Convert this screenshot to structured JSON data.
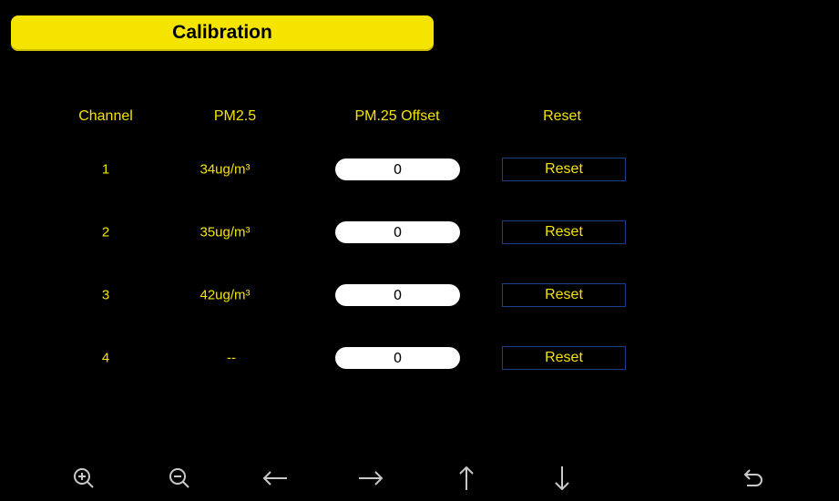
{
  "header": {
    "title": "Calibration"
  },
  "columns": {
    "channel": "Channel",
    "pm25": "PM2.5",
    "offset": "PM.25 Offset",
    "reset": "Reset"
  },
  "rows": [
    {
      "channel": "1",
      "pm25": "34ug/m³",
      "offset": "0",
      "reset_label": "Reset"
    },
    {
      "channel": "2",
      "pm25": "35ug/m³",
      "offset": "0",
      "reset_label": "Reset"
    },
    {
      "channel": "3",
      "pm25": "42ug/m³",
      "offset": "0",
      "reset_label": "Reset"
    },
    {
      "channel": "4",
      "pm25": "--",
      "offset": "0",
      "reset_label": "Reset"
    }
  ],
  "toolbar": {
    "icons": [
      "zoom-in-icon",
      "zoom-out-icon",
      "arrow-left-icon",
      "arrow-right-icon",
      "arrow-up-icon",
      "arrow-down-icon",
      "back-icon"
    ]
  },
  "colors": {
    "accent_yellow": "#f5e400",
    "background": "#000000",
    "button_border": "#1c3d8a",
    "icon_gray": "#c8c8c8"
  }
}
